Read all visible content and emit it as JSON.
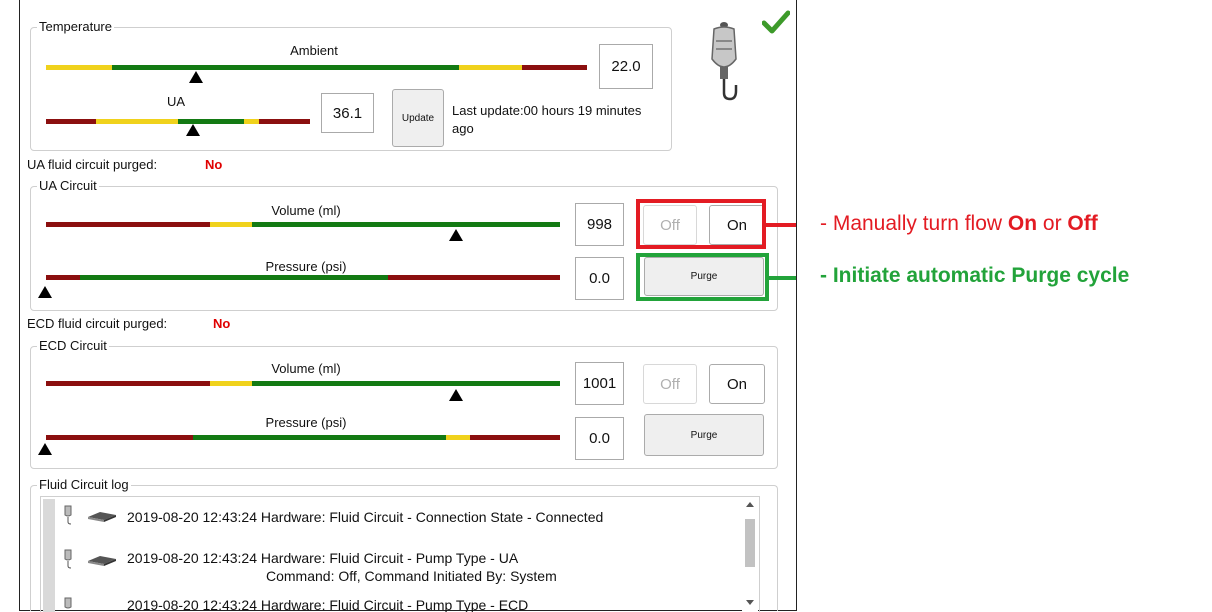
{
  "temperature": {
    "legend": "Temperature",
    "ambient": {
      "title": "Ambient",
      "value": "22.0",
      "level": 0.4
    },
    "ua": {
      "title": "UA",
      "value": "36.1",
      "update_label": "Update",
      "last_update": "Last update:00 hours 19 minutes ago",
      "level": 0.58
    },
    "status_icon": "checkmark-icon",
    "device_icon": "fluid-bag-icon"
  },
  "ua_purged": {
    "label": "UA fluid circuit purged:",
    "value": "No"
  },
  "ua_circuit": {
    "legend": "UA Circuit",
    "volume": {
      "title": "Volume (ml)",
      "value": "998",
      "level": 0.8
    },
    "pressure": {
      "title": "Pressure (psi)",
      "value": "0.0",
      "level": 0.0
    },
    "off_label": "Off",
    "on_label": "On",
    "purge_label": "Purge"
  },
  "ecd_purged": {
    "label": "ECD fluid circuit purged:",
    "value": "No"
  },
  "ecd_circuit": {
    "legend": "ECD Circuit",
    "volume": {
      "title": "Volume (ml)",
      "value": "1001",
      "level": 0.8
    },
    "pressure": {
      "title": "Pressure (psi)",
      "value": "0.0",
      "level": 0.0
    },
    "off_label": "Off",
    "on_label": "On",
    "purge_label": "Purge"
  },
  "log": {
    "legend": "Fluid Circuit log",
    "entries": [
      {
        "line1": "2019-08-20 12:43:24 Hardware: Fluid Circuit - Connection State - Connected",
        "line2": ""
      },
      {
        "line1": "2019-08-20 12:43:24 Hardware: Fluid Circuit - Pump Type - UA",
        "line2": "Command: Off, Command Initiated By: System"
      },
      {
        "line1": "2019-08-20 12:43:24 Hardware: Fluid Circuit - Pump Type - ECD",
        "line2": ""
      }
    ]
  },
  "annotations": {
    "flow": {
      "prefix": "- Manually turn flow ",
      "on": "On",
      "mid": " or ",
      "off": "Off",
      "color": "#e31b23"
    },
    "purge": {
      "text": "- Initiate automatic Purge cycle",
      "color": "#22a33a"
    }
  }
}
